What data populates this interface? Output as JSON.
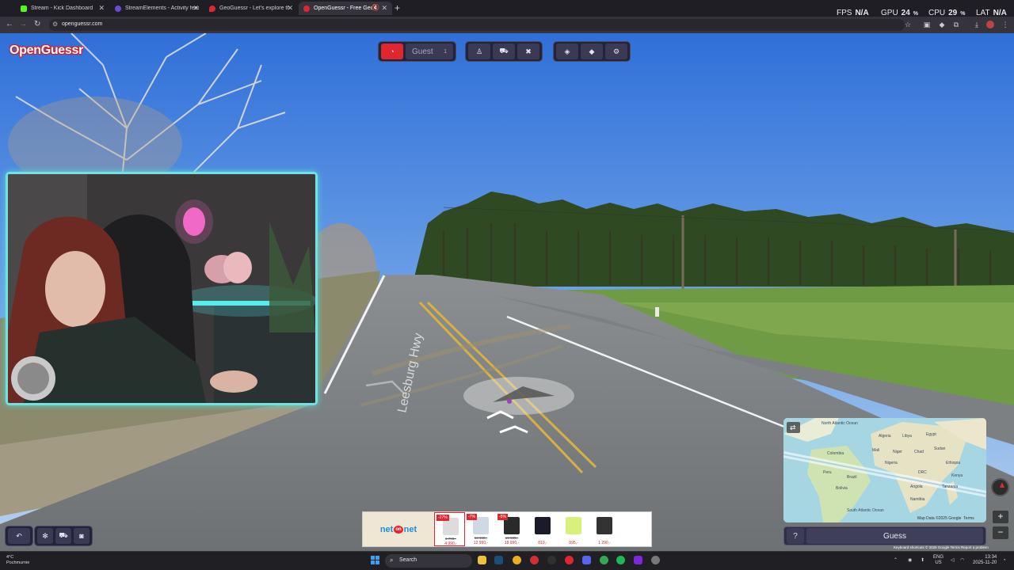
{
  "browser": {
    "tabs": [
      {
        "title": "Stream - Kick Dashboard",
        "color": "#53fc18"
      },
      {
        "title": "StreamElements - Activity feed",
        "color": "#6b4bd6"
      },
      {
        "title": "GeoGuessr - Let's explore the world!",
        "color": "#e0262e"
      },
      {
        "title": "OpenGuessr - Free GeoGu",
        "color": "#e0262e"
      }
    ],
    "url": "openguessr.com"
  },
  "perf": {
    "fps_label": "FPS",
    "fps_value": "N/A",
    "gpu_label": "GPU",
    "gpu_value": "24",
    "gpu_unit": "%",
    "cpu_label": "CPU",
    "cpu_value": "29",
    "cpu_unit": "%",
    "lat_label": "LAT",
    "lat_value": "N/A"
  },
  "game": {
    "logo": "OpenGuessr",
    "guest_label": "Guest",
    "guest_count": "1",
    "guess_label": "Guess",
    "help_label": "?",
    "map_credit": "Map Data ©2025 Google",
    "map_terms": "Terms",
    "attribution": "Keyboard shortcuts   © 2025 Google   Terms   Report a problem",
    "road_label": "Leesburg Hwy",
    "zoom_in": "+",
    "zoom_out": "−",
    "map_labels": [
      "North Atlantic Ocean",
      "Algeria",
      "Libya",
      "Egypt",
      "Mali",
      "Niger",
      "Chad",
      "Sudan",
      "Nigeria",
      "Ethiopia",
      "Kenya",
      "DRC",
      "Tanzania",
      "Angola",
      "Namibia",
      "Colombia",
      "Peru",
      "Brazil",
      "Bolivia",
      "South Atlantic Ocean"
    ]
  },
  "ad": {
    "brand_pre": "net",
    "brand_on": "on",
    "brand_post": "net",
    "products": [
      {
        "discount": "-27%",
        "old": "6 790,-",
        "price": "4 990,-",
        "color": "#dcdcdc"
      },
      {
        "discount": "-7%",
        "old": "13 988,-",
        "price": "12 990,-",
        "color": "#cfd9e6"
      },
      {
        "discount": "-5%",
        "old": "19 989,-",
        "price": "18 990,-",
        "color": "#2a2a2a"
      },
      {
        "discount": "",
        "old": "",
        "price": "819,-",
        "color": "#1a1a2a"
      },
      {
        "discount": "",
        "old": "",
        "price": "895,-",
        "color": "#d9f07a"
      },
      {
        "discount": "",
        "old": "",
        "price": "1 290,-",
        "color": "#333333"
      }
    ]
  },
  "taskbar": {
    "weather_temp": "4°C",
    "weather_desc": "Pochmurnie",
    "search": "Search",
    "lang": "ENG",
    "region": "US",
    "time": "13:34",
    "date": "2025-11-20"
  }
}
